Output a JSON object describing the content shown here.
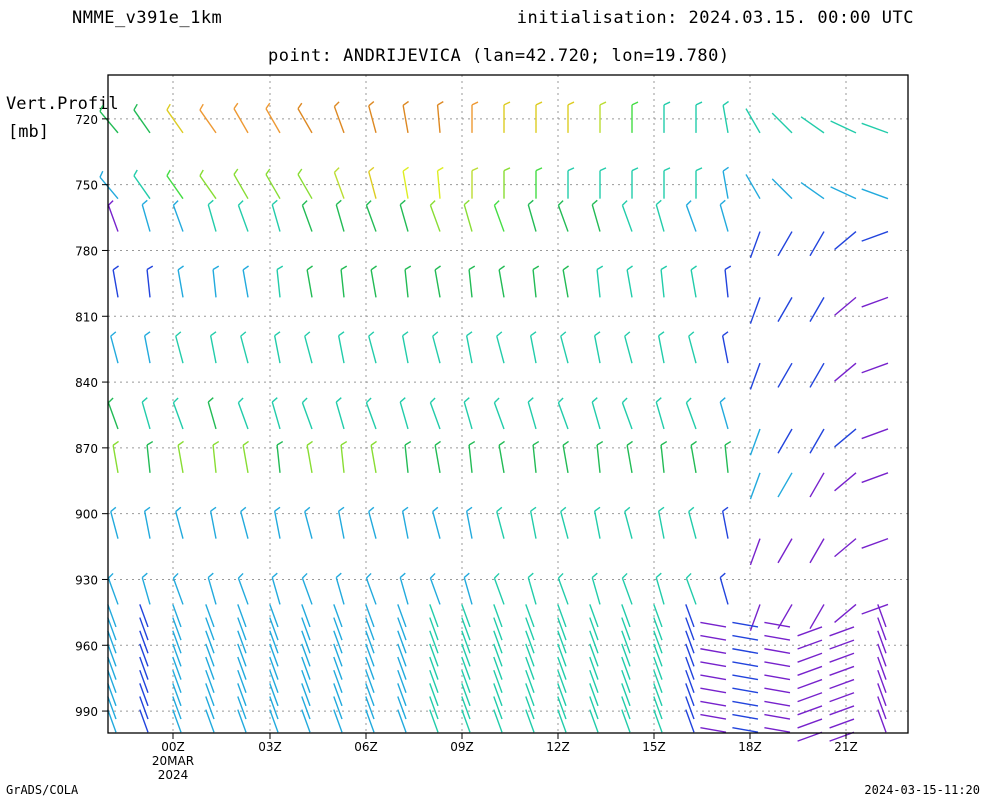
{
  "header": {
    "model": "NMME_v391e_1km",
    "initialisation": "initialisation: 2024.03.15. 00:00 UTC",
    "point": "point: ANDRIJEVICA (lan=42.720; lon=19.780)"
  },
  "footer": {
    "left": "GrADS/COLA",
    "right": "2024-03-15-11:20"
  },
  "chart_data": {
    "type": "wind-barbs",
    "ylabel": [
      "Vert.Profil",
      "[mb]"
    ],
    "y_axis": {
      "ticks": [
        720,
        750,
        780,
        810,
        840,
        870,
        900,
        930,
        960,
        990
      ],
      "range": [
        700,
        1000
      ],
      "direction": "increasing downward (pressure)"
    },
    "x_axis": {
      "range_hours": [
        "19MAR 22Z",
        "20MAR 22:30Z"
      ],
      "ticks": [
        "00Z",
        "03Z",
        "06Z",
        "09Z",
        "12Z",
        "15Z",
        "18Z",
        "21Z"
      ],
      "date_label": [
        "20MAR",
        "2024"
      ],
      "grid": true
    },
    "rows": [
      {
        "level": 720,
        "colors": [
          "#22bb55",
          "#22bb55",
          "#ddcc22",
          "#ee9933",
          "#ee9933",
          "#ee9933",
          "#dd8822",
          "#dd8822",
          "#dd8822",
          "#dd8822",
          "#dd8822",
          "#ee9933",
          "#ddcc22",
          "#ddcc22",
          "#ddcc22",
          "#bbdd33",
          "#44dd44",
          "#22ccaa",
          "#22ccaa",
          "#22ccaa",
          "#22ccaa",
          "#22ccaa",
          "#22ccaa",
          "#22ccaa",
          "#22ccaa"
        ]
      },
      {
        "level": 750,
        "colors": [
          "#22aadd",
          "#22ccaa",
          "#44dd44",
          "#88dd33",
          "#88dd33",
          "#88dd33",
          "#88dd33",
          "#bbdd33",
          "#ddcc22",
          "#ddee22",
          "#ddee22",
          "#bbdd33",
          "#88dd33",
          "#44dd44",
          "#22ccaa",
          "#22ccaa",
          "#22ccaa",
          "#22ccaa",
          "#22ccaa",
          "#22aadd",
          "#22aadd",
          "#22aadd",
          "#22aadd",
          "#22aadd",
          "#22aadd"
        ]
      },
      {
        "level": 765,
        "colors": [
          "#7722cc",
          "#22aadd",
          "#22aadd",
          "#22ccaa",
          "#22ccaa",
          "#22ccaa",
          "#22bb55",
          "#22bb55",
          "#22bb55",
          "#22bb55",
          "#88dd33",
          "#88dd33",
          "#44dd44",
          "#22bb55",
          "#22bb55",
          "#22bb55",
          "#22ccaa",
          "#22ccaa",
          "#22aadd",
          "#22aadd",
          "#2244dd",
          "#2244dd",
          "#2244dd",
          "#2244dd",
          "#2244dd"
        ]
      },
      {
        "level": 795,
        "colors": [
          "#2244dd",
          "#2244dd",
          "#22aadd",
          "#22aadd",
          "#22aadd",
          "#22ccaa",
          "#22bb55",
          "#22bb55",
          "#22bb55",
          "#22bb55",
          "#22bb55",
          "#22bb55",
          "#22bb55",
          "#22bb55",
          "#22bb55",
          "#22ccaa",
          "#22ccaa",
          "#22ccaa",
          "#22ccaa",
          "#2244dd",
          "#2244dd",
          "#2244dd",
          "#2244dd",
          "#7722cc",
          "#7722cc"
        ]
      },
      {
        "level": 825,
        "colors": [
          "#22aadd",
          "#22aadd",
          "#22ccaa",
          "#22ccaa",
          "#22ccaa",
          "#22ccaa",
          "#22ccaa",
          "#22ccaa",
          "#22ccaa",
          "#22ccaa",
          "#22ccaa",
          "#22ccaa",
          "#22ccaa",
          "#22ccaa",
          "#22ccaa",
          "#22ccaa",
          "#22ccaa",
          "#22ccaa",
          "#22ccaa",
          "#2244dd",
          "#2244dd",
          "#2244dd",
          "#2244dd",
          "#7722cc",
          "#7722cc"
        ]
      },
      {
        "level": 855,
        "colors": [
          "#22bb55",
          "#22ccaa",
          "#22ccaa",
          "#22bb55",
          "#22ccaa",
          "#22ccaa",
          "#22ccaa",
          "#22ccaa",
          "#22ccaa",
          "#22ccaa",
          "#22ccaa",
          "#22ccaa",
          "#22ccaa",
          "#22ccaa",
          "#22ccaa",
          "#22ccaa",
          "#22ccaa",
          "#22ccaa",
          "#22ccaa",
          "#22aadd",
          "#22aadd",
          "#2244dd",
          "#2244dd",
          "#2244dd",
          "#7722cc"
        ]
      },
      {
        "level": 875,
        "colors": [
          "#88dd33",
          "#22bb55",
          "#88dd33",
          "#88dd33",
          "#88dd33",
          "#22bb55",
          "#88dd33",
          "#88dd33",
          "#88dd33",
          "#22bb55",
          "#22bb55",
          "#22bb55",
          "#22bb55",
          "#22bb55",
          "#22bb55",
          "#22bb55",
          "#22bb55",
          "#22bb55",
          "#22bb55",
          "#22bb55",
          "#22aadd",
          "#22aadd",
          "#7722cc",
          "#7722cc",
          "#7722cc"
        ]
      },
      {
        "level": 905,
        "colors": [
          "#22aadd",
          "#22aadd",
          "#22aadd",
          "#22aadd",
          "#22aadd",
          "#22aadd",
          "#22aadd",
          "#22aadd",
          "#22aadd",
          "#22aadd",
          "#22aadd",
          "#22aadd",
          "#22ccaa",
          "#22ccaa",
          "#22ccaa",
          "#22ccaa",
          "#22ccaa",
          "#22ccaa",
          "#22ccaa",
          "#2244dd",
          "#7722cc",
          "#7722cc",
          "#7722cc",
          "#7722cc",
          "#7722cc"
        ]
      },
      {
        "level": 935,
        "colors": [
          "#22aadd",
          "#22aadd",
          "#22aadd",
          "#22aadd",
          "#22aadd",
          "#22aadd",
          "#22aadd",
          "#22aadd",
          "#22aadd",
          "#22aadd",
          "#22aadd",
          "#22aadd",
          "#22ccaa",
          "#22ccaa",
          "#22ccaa",
          "#22ccaa",
          "#22ccaa",
          "#22ccaa",
          "#22ccaa",
          "#2244dd",
          "#7722cc",
          "#7722cc",
          "#7722cc",
          "#7722cc",
          "#7722cc"
        ]
      }
    ],
    "surface_rows": {
      "levels": [
        948,
        954,
        960,
        966,
        972,
        978,
        984,
        990,
        996
      ],
      "colors": [
        "#22aadd",
        "#2244dd",
        "#22aadd",
        "#22aadd",
        "#22aadd",
        "#22aadd",
        "#22aadd",
        "#22aadd",
        "#22aadd",
        "#22aadd",
        "#22ccaa",
        "#22ccaa",
        "#22ccaa",
        "#22ccaa",
        "#22ccaa",
        "#22ccaa",
        "#22ccaa",
        "#22ccaa",
        "#2244dd",
        "#7722cc",
        "#2244dd",
        "#7722cc",
        "#7722cc",
        "#7722cc",
        "#7722cc"
      ]
    }
  }
}
